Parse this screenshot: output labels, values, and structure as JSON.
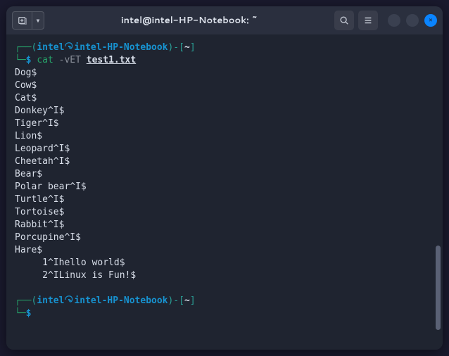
{
  "window": {
    "title": "intel@intel-HP-Notebook: ~"
  },
  "prompt": {
    "open_paren": "(",
    "user": "intel",
    "host": "intel-HP-Notebook",
    "close_paren": ")",
    "dash": "-",
    "lbracket": "[",
    "path": "~",
    "rbracket": "]",
    "dollar": "$"
  },
  "command": {
    "cmd": "cat",
    "flags": "-vET",
    "arg": "test1.txt"
  },
  "output": [
    "Dog$",
    "Cow$",
    "Cat$",
    "Donkey^I$",
    "Tiger^I$",
    "Lion$",
    "Leopard^I$",
    "Cheetah^I$",
    "Bear$",
    "Polar bear^I$",
    "Turtle^I$",
    "Tortoise$",
    "Rabbit^I$",
    "Porcupine^I$",
    "Hare$",
    "     1^Ihello world$",
    "     2^ILinux is Fun!$"
  ],
  "icons": {
    "newtab": "⊞",
    "dropdown": "▾",
    "search": "search",
    "menu": "≡",
    "minimize": "",
    "maximize": "",
    "close": "✕"
  }
}
